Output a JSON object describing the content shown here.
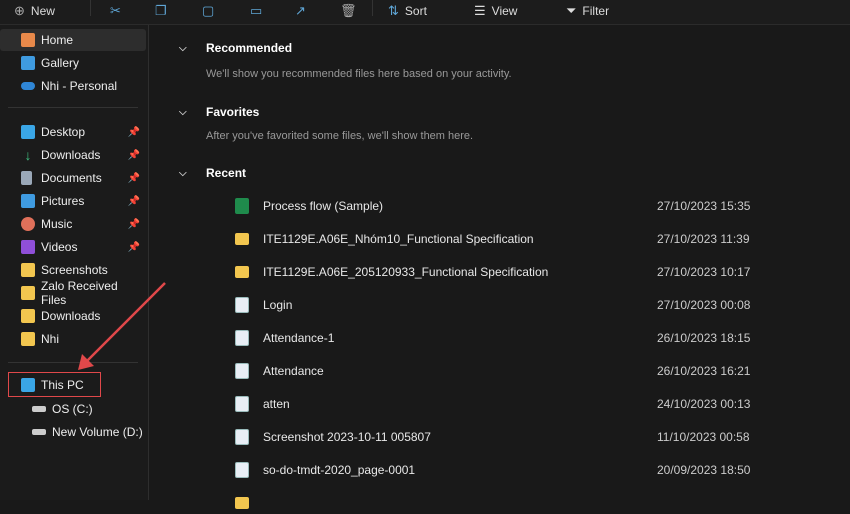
{
  "toolbar": {
    "new": "New",
    "sort": "Sort",
    "view": "View",
    "filter": "Filter"
  },
  "sidebar": {
    "top": [
      {
        "label": "Home",
        "icon": "home-icon",
        "color": "#e8894a"
      },
      {
        "label": "Gallery",
        "icon": "gallery-icon",
        "color": "#3f9be0"
      },
      {
        "label": "Nhi - Personal",
        "icon": "onedrive-icon",
        "color": "#2f86d6"
      }
    ],
    "pinned": [
      {
        "label": "Desktop",
        "icon": "desktop-icon",
        "color": "#3aa6e6"
      },
      {
        "label": "Downloads",
        "icon": "download-icon",
        "color": "#3fbf7f"
      },
      {
        "label": "Documents",
        "icon": "documents-icon",
        "color": "#9aa8b8"
      },
      {
        "label": "Pictures",
        "icon": "pictures-icon",
        "color": "#3f9be0"
      },
      {
        "label": "Music",
        "icon": "music-icon",
        "color": "#e0705a"
      },
      {
        "label": "Videos",
        "icon": "videos-icon",
        "color": "#8f4fd8"
      }
    ],
    "folders": [
      {
        "label": "Screenshots"
      },
      {
        "label": "Zalo Received Files"
      },
      {
        "label": "Downloads"
      },
      {
        "label": "Nhi"
      }
    ],
    "this_pc": "This PC",
    "drives": [
      {
        "label": "OS (C:)"
      },
      {
        "label": "New Volume (D:)"
      }
    ]
  },
  "main": {
    "recommended": {
      "title": "Recommended",
      "hint": "We'll show you recommended files here based on your activity."
    },
    "favorites": {
      "title": "Favorites",
      "hint": "After you've favorited some files, we'll show them here."
    },
    "recent": {
      "title": "Recent",
      "items": [
        {
          "name": "Process flow (Sample)",
          "date": "27/10/2023 15:35",
          "type": "xls"
        },
        {
          "name": "ITE1129E.A06E_Nhóm10_Functional Specification",
          "date": "27/10/2023 11:39",
          "type": "fold"
        },
        {
          "name": "ITE1129E.A06E_205120933_Functional Specification",
          "date": "27/10/2023 10:17",
          "type": "fold"
        },
        {
          "name": "Login",
          "date": "27/10/2023 00:08",
          "type": "img"
        },
        {
          "name": "Attendance-1",
          "date": "26/10/2023 18:15",
          "type": "img"
        },
        {
          "name": "Attendance",
          "date": "26/10/2023 16:21",
          "type": "img"
        },
        {
          "name": "atten",
          "date": "24/10/2023 00:13",
          "type": "img"
        },
        {
          "name": "Screenshot 2023-10-11 005807",
          "date": "11/10/2023 00:58",
          "type": "img"
        },
        {
          "name": "so-do-tmdt-2020_page-0001",
          "date": "20/09/2023 18:50",
          "type": "img"
        }
      ]
    }
  },
  "annotation_color": "#e0484a"
}
